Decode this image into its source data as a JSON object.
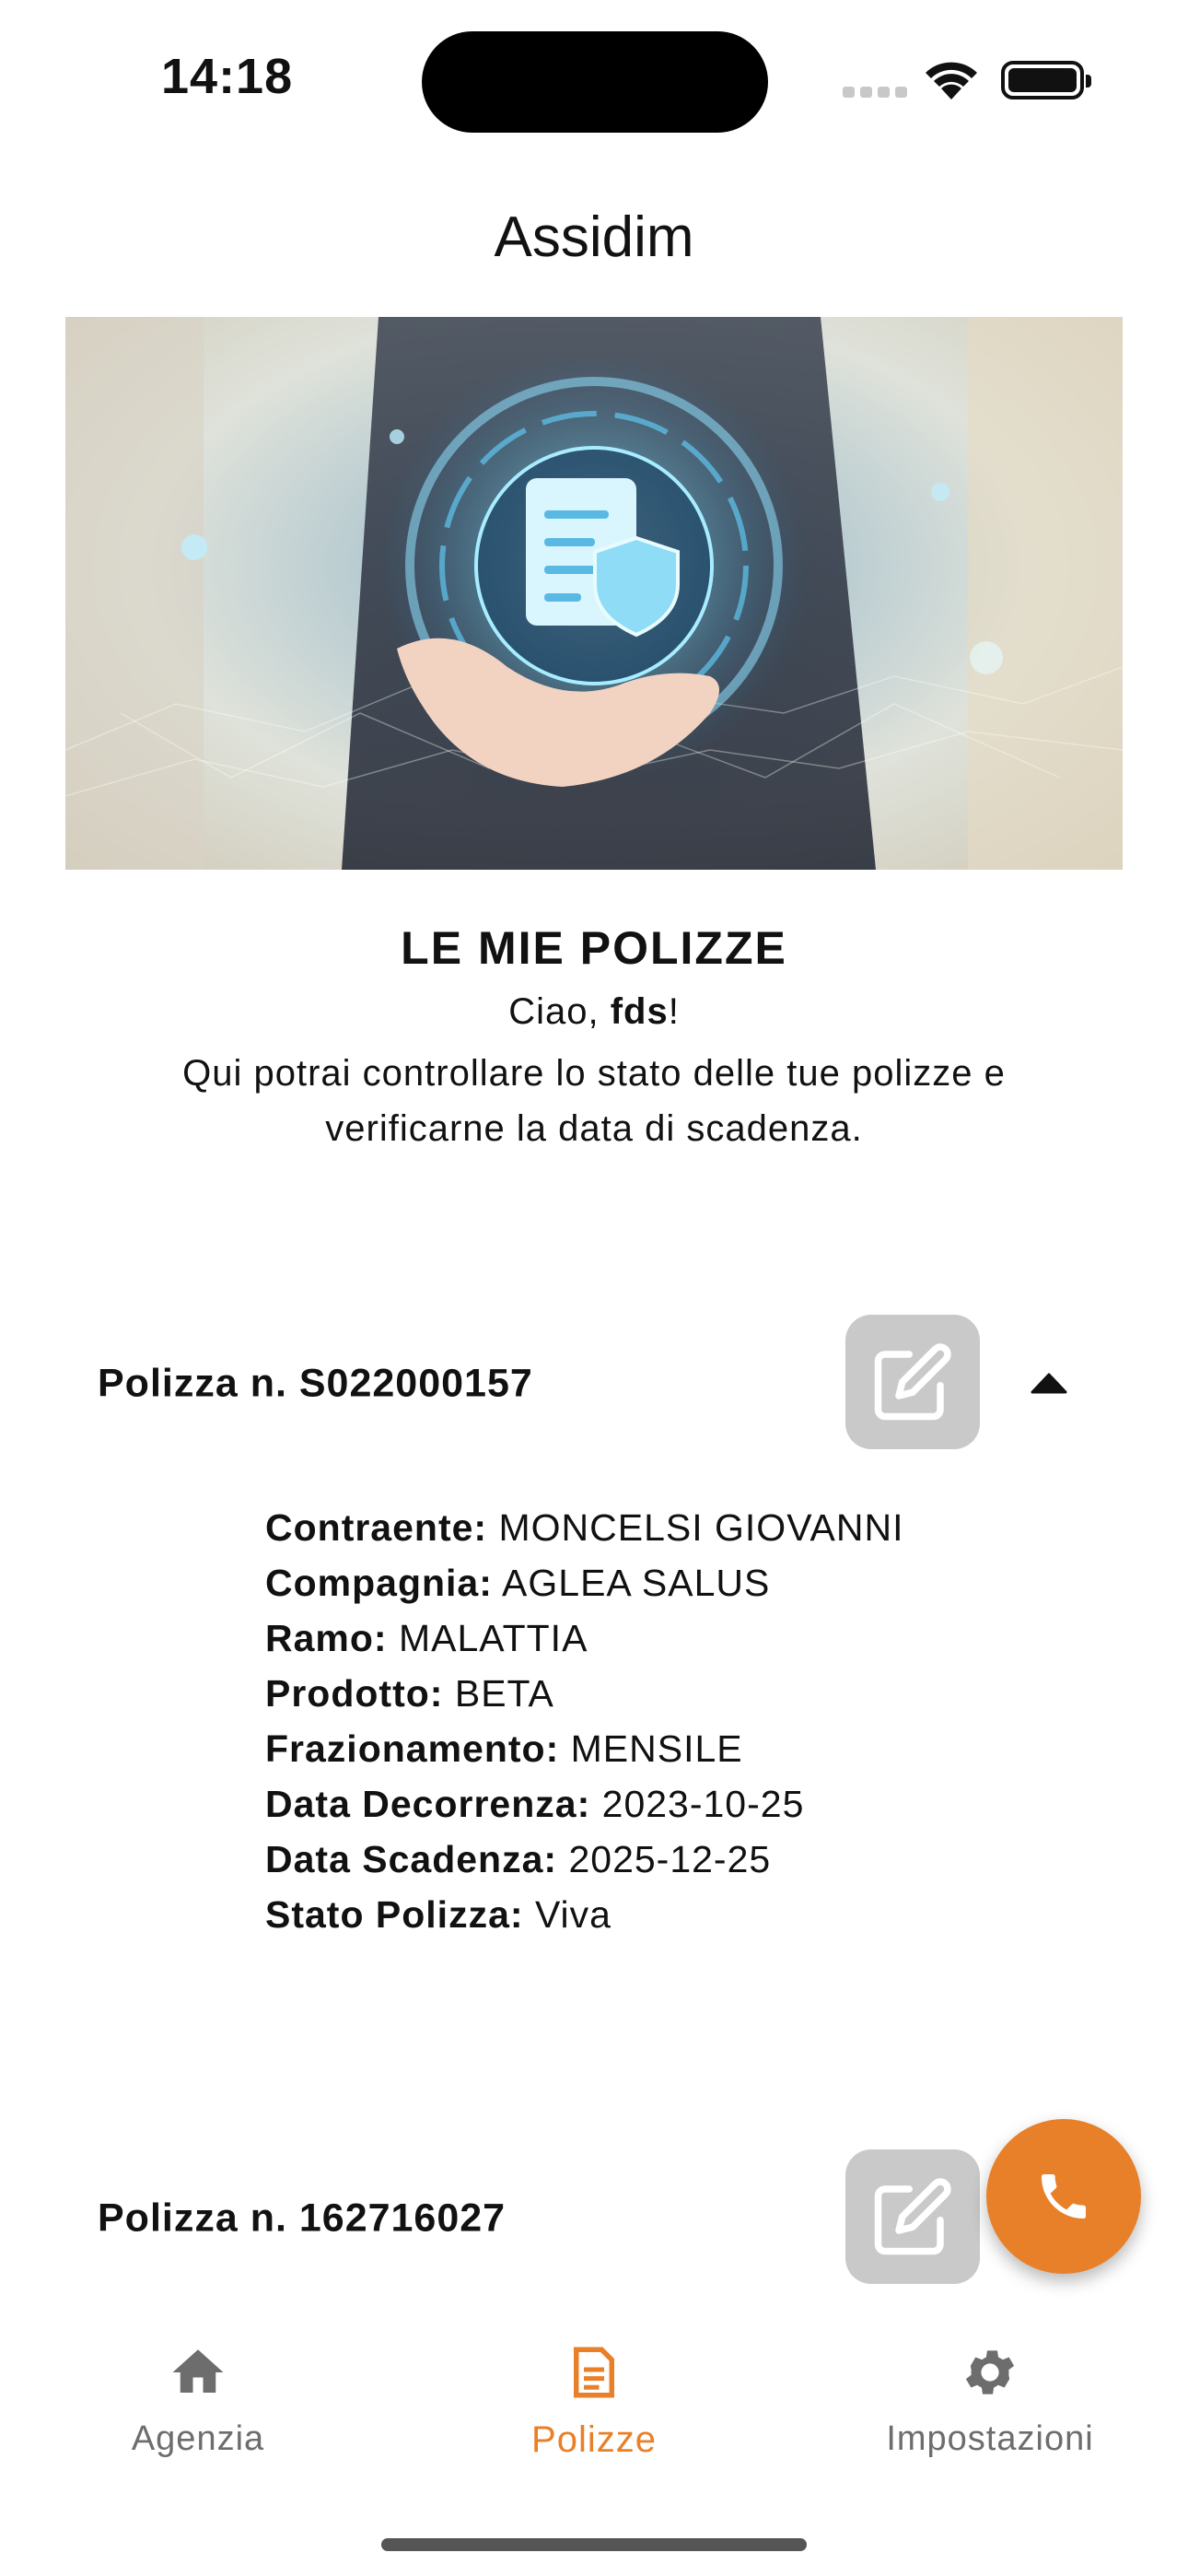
{
  "status_bar": {
    "time": "14:18"
  },
  "header": {
    "title": "Assidim"
  },
  "intro": {
    "title": "LE MIE POLIZZE",
    "greeting_prefix": "Ciao, ",
    "user_name": "fds",
    "greeting_suffix": "!",
    "description": "Qui potrai controllare lo stato delle tue polizze e verificarne la data di scadenza."
  },
  "policies": [
    {
      "title": "Polizza n. S022000157",
      "expanded": true,
      "details": [
        {
          "label": "Contraente:",
          "value": "MONCELSI GIOVANNI"
        },
        {
          "label": "Compagnia:",
          "value": "AGLEA SALUS"
        },
        {
          "label": "Ramo:",
          "value": "MALATTIA"
        },
        {
          "label": "Prodotto:",
          "value": "BETA"
        },
        {
          "label": "Frazionamento:",
          "value": "MENSILE"
        },
        {
          "label": "Data Decorrenza:",
          "value": "2023-10-25"
        },
        {
          "label": "Data Scadenza:",
          "value": "2025-12-25"
        },
        {
          "label": "Stato Polizza:",
          "value": "Viva"
        }
      ]
    },
    {
      "title": "Polizza n. 162716027",
      "expanded": false
    }
  ],
  "tabbar": {
    "items": [
      {
        "label": "Agenzia",
        "icon": "home-icon",
        "active": false
      },
      {
        "label": "Polizze",
        "icon": "document-icon",
        "active": true
      },
      {
        "label": "Impostazioni",
        "icon": "gear-icon",
        "active": false
      }
    ]
  },
  "colors": {
    "accent": "#e8802a",
    "edit_button": "#c9c9c9",
    "inactive_tab": "#6d6d6d"
  }
}
